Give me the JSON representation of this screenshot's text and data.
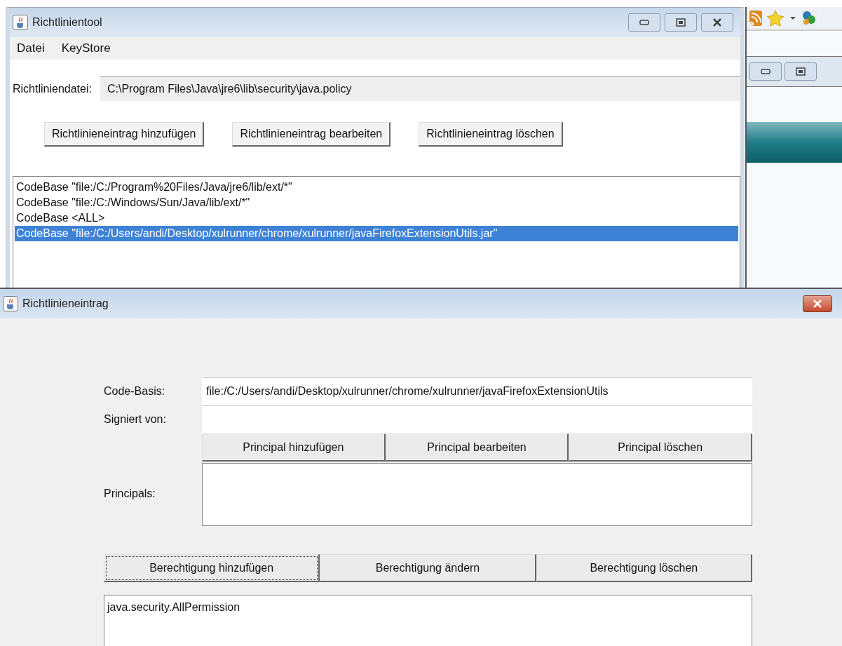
{
  "main_window": {
    "title": "Richtlinientool",
    "menu": [
      "Datei",
      "KeyStore"
    ],
    "policy_file": {
      "label": "Richtliniendatei:",
      "value": "C:\\Program Files\\Java\\jre6\\lib\\security\\java.policy"
    },
    "buttons": [
      "Richtlinieneintrag hinzufügen",
      "Richtlinieneintrag bearbeiten",
      "Richtlinieneintrag löschen"
    ],
    "entries": [
      {
        "text": "CodeBase \"file:/C:/Program%20Files/Java/jre6/lib/ext/*\"",
        "selected": false
      },
      {
        "text": "CodeBase \"file:/C:/Windows/Sun/Java/lib/ext/*\"",
        "selected": false
      },
      {
        "text": "CodeBase <ALL>",
        "selected": false
      },
      {
        "text": "CodeBase \"file:/C:/Users/andi/Desktop/xulrunner/chrome/xulrunner/javaFirefoxExtensionUtils.jar\"",
        "selected": true
      }
    ]
  },
  "dialog": {
    "title": "Richtlinieneintrag",
    "code_base": {
      "label": "Code-Basis:",
      "value": "file:/C:/Users/andi/Desktop/xulrunner/chrome/xulrunner/javaFirefoxExtensionUtils"
    },
    "signed_by": {
      "label": "Signiert von:"
    },
    "principal_buttons": [
      "Principal hinzufügen",
      "Principal bearbeiten",
      "Principal löschen"
    ],
    "principals": {
      "label": "Principals:"
    },
    "permission_buttons": [
      {
        "label": "Berechtigung hinzufügen",
        "focused": true
      },
      {
        "label": "Berechtigung ändern",
        "focused": false
      },
      {
        "label": "Berechtigung löschen",
        "focused": false
      }
    ],
    "permissions": [
      "java.security.AllPermission"
    ]
  }
}
